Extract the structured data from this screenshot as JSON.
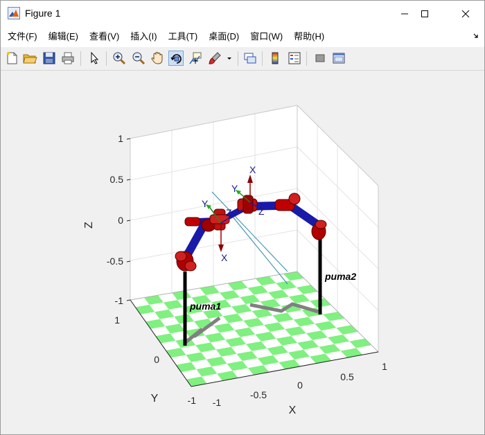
{
  "window": {
    "title": "Figure 1",
    "controls": [
      "minimize",
      "maximize",
      "close"
    ]
  },
  "menu": [
    {
      "label": "文件(F)"
    },
    {
      "label": "编辑(E)"
    },
    {
      "label": "查看(V)"
    },
    {
      "label": "插入(I)"
    },
    {
      "label": "工具(T)"
    },
    {
      "label": "桌面(D)"
    },
    {
      "label": "窗口(W)"
    },
    {
      "label": "帮助(H)"
    }
  ],
  "toolbar": {
    "buttons": [
      {
        "icon": "new-figure-icon"
      },
      {
        "icon": "open-file-icon"
      },
      {
        "icon": "save-icon"
      },
      {
        "icon": "print-icon"
      },
      {
        "icon": "edit-plot-arrow-icon"
      },
      {
        "icon": "zoom-in-icon"
      },
      {
        "icon": "zoom-out-icon"
      },
      {
        "icon": "pan-hand-icon"
      },
      {
        "icon": "rotate-3d-icon",
        "pressed": true
      },
      {
        "icon": "data-cursor-icon"
      },
      {
        "icon": "brush-icon"
      },
      {
        "icon": "link-plot-icon"
      },
      {
        "icon": "colorbar-icon"
      },
      {
        "icon": "legend-icon"
      },
      {
        "icon": "hide-plot-tools-icon"
      },
      {
        "icon": "show-plot-tools-icon"
      }
    ]
  },
  "plot": {
    "xlabel": "X",
    "ylabel": "Y",
    "zlabel": "Z",
    "x_ticks": [
      "-1",
      "-0.5",
      "0",
      "0.5",
      "1"
    ],
    "y_ticks": [
      "-1",
      "0",
      "1"
    ],
    "z_ticks": [
      "1",
      "0.5",
      "0",
      "-0.5",
      "-1"
    ],
    "robots": [
      {
        "name": "puma1",
        "color": "#1a1aa8"
      },
      {
        "name": "puma2",
        "color": "#1a1aa8"
      }
    ],
    "frame_labels": {
      "x1": "X",
      "y1": "Y",
      "z1": "Z",
      "x2": "X",
      "y2": "Y",
      "z2": "Z"
    },
    "floor_colors": [
      "#80f080",
      "#ffffff"
    ],
    "link_color": "#c00000",
    "shadow_color": "#808080"
  }
}
